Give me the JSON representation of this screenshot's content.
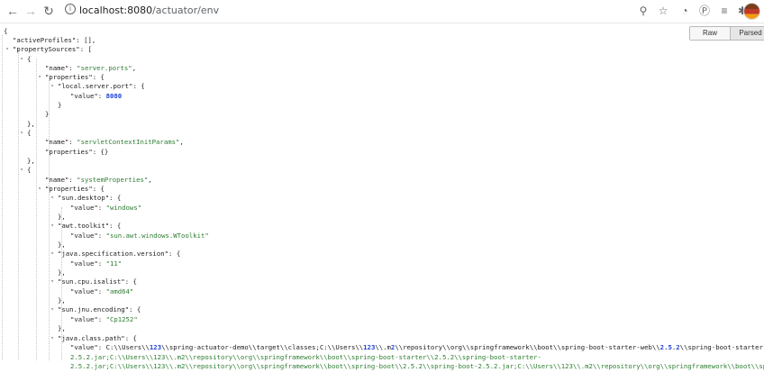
{
  "browser": {
    "url_host": "localhost:8080",
    "url_path": "/actuator/env",
    "info_glyph": "i",
    "colors": {
      "string": "#2e7d32",
      "number": "#1a3fd6",
      "key": "#222222"
    }
  },
  "viewer": {
    "raw_label": "Raw",
    "parsed_label": "Parsed"
  },
  "json": [
    "{",
    "\"activeProfiles\": [],",
    "\"propertySources\": [",
    "{",
    "\"name\": \"server.ports\",",
    "\"properties\": {",
    "\"local.server.port\": {",
    "\"value\": 8080",
    "}",
    "}",
    "},",
    "{",
    "\"name\": \"servletContextInitParams\",",
    "\"properties\": {}",
    "},",
    "{",
    "\"name\": \"systemProperties\",",
    "\"properties\": {",
    "\"sun.desktop\": {",
    "\"value\": \"windows\"",
    "},",
    "\"awt.toolkit\": {",
    "\"value\": \"sun.awt.windows.WToolkit\"",
    "},",
    "\"java.specification.version\": {",
    "\"value\": \"11\"",
    "},",
    "\"sun.cpu.isalist\": {",
    "\"value\": \"amd64\"",
    "},",
    "\"sun.jnu.encoding\": {",
    "\"value\": \"Cp1252\"",
    "},",
    "\"java.class.path\": {",
    "\"value\": \"C:\\\\Users\\\\123\\\\spring-actuator-demo\\\\target\\\\classes;C:\\\\Users\\\\123\\\\.m2\\\\repository\\\\org\\\\springframework\\\\boot\\\\spring-boot-starter-web\\\\2.5.2\\\\spring-boot-starter-web-",
    "2.5.2.jar;C:\\\\Users\\\\123\\\\.m2\\\\repository\\\\org\\\\springframework\\\\boot\\\\spring-boot-starter\\\\2.5.2\\\\spring-boot-starter-",
    "2.5.2.jar;C:\\\\Users\\\\123\\\\.m2\\\\repository\\\\org\\\\springframework\\\\boot\\\\spring-boot\\\\2.5.2\\\\spring-boot-2.5.2.jar;C:\\\\Users\\\\123\\\\.m2\\\\repository\\\\org\\\\springframework\\\\boot\\\\spring-bo"
  ]
}
